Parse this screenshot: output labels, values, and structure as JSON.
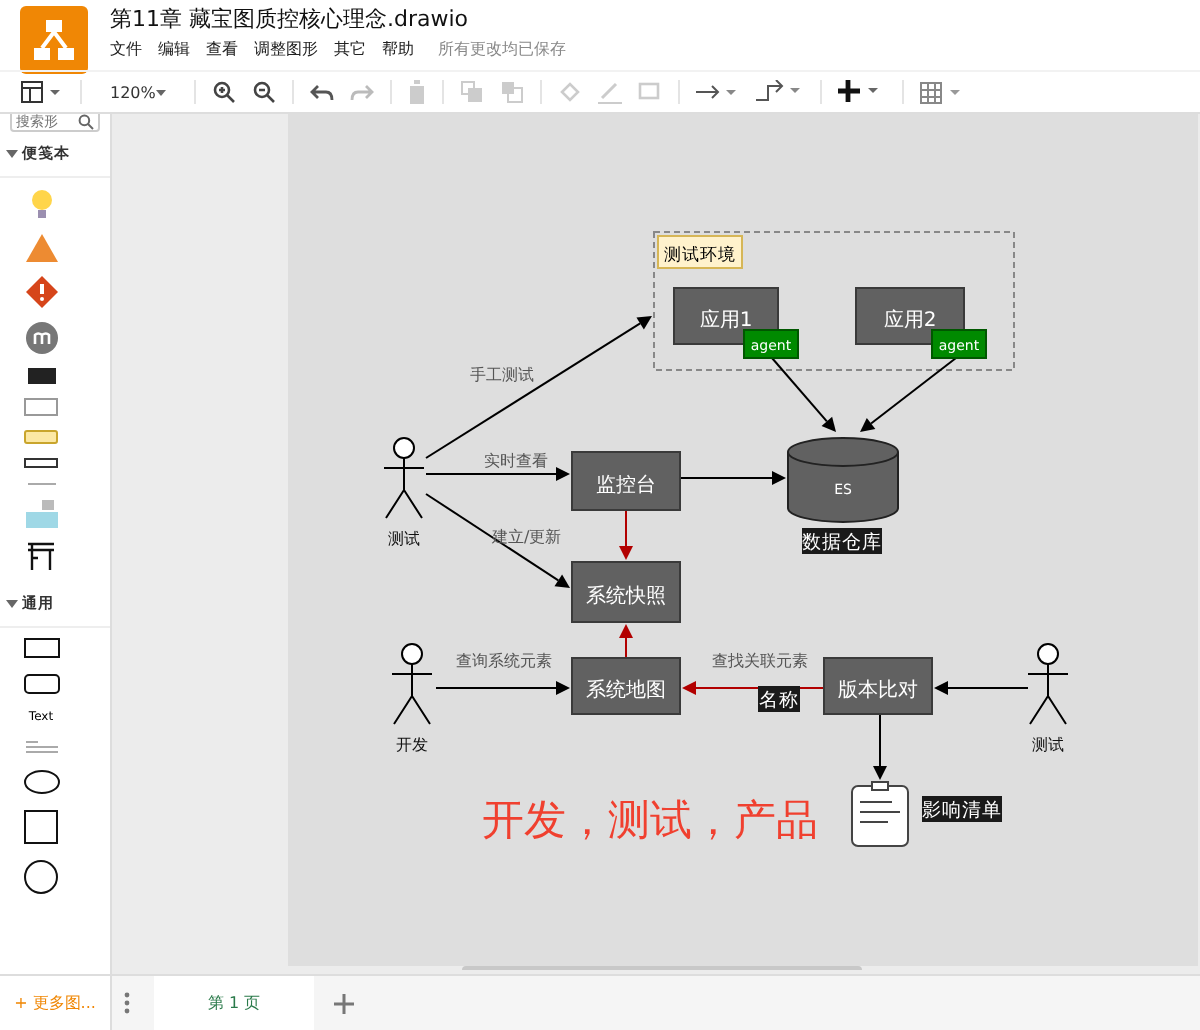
{
  "window": {
    "title": "第11章 藏宝图质控核心理念.drawio"
  },
  "menu": [
    "文件",
    "编辑",
    "查看",
    "调整图形",
    "其它",
    "帮助"
  ],
  "save_status": "所有更改均已保存",
  "toolbar": {
    "zoom": "120%"
  },
  "sidebar": {
    "search": {
      "placeholder": "搜索形"
    },
    "sections": [
      {
        "title": "便笺本",
        "expanded": true
      },
      {
        "title": "通用",
        "expanded": true
      }
    ],
    "general_text": "Text",
    "more_button": "+ 更多图..."
  },
  "diagram": {
    "group": {
      "label": "测试环境"
    },
    "nodes": [
      {
        "kind": "box",
        "text": "应用1"
      },
      {
        "kind": "box",
        "text": "应用2"
      },
      {
        "kind": "badge",
        "text": "agent"
      },
      {
        "kind": "badge",
        "text": "agent"
      },
      {
        "kind": "database",
        "text": "ES"
      },
      {
        "kind": "actor",
        "text": "测试"
      },
      {
        "kind": "box",
        "text": "监控台"
      },
      {
        "kind": "box",
        "text": "系统快照"
      },
      {
        "kind": "box",
        "text": "系统地图"
      },
      {
        "kind": "box",
        "text": "版本比对"
      },
      {
        "kind": "actor",
        "text": "开发"
      },
      {
        "kind": "actor",
        "text": "测试"
      },
      {
        "kind": "document"
      }
    ],
    "labels": [
      {
        "kind": "edge",
        "text": "手工测试"
      },
      {
        "kind": "edge",
        "text": "实时查看"
      },
      {
        "kind": "edge",
        "text": "建立/更新"
      },
      {
        "kind": "edge",
        "text": "查询系统元素"
      },
      {
        "kind": "edge",
        "text": "查找关联元素"
      },
      {
        "kind": "tag",
        "text": "数据仓库"
      },
      {
        "kind": "tag",
        "text": "名称"
      },
      {
        "kind": "tag",
        "text": "影响清单"
      },
      {
        "kind": "caption",
        "text": "开发，测试，产品"
      }
    ],
    "edges": [
      {
        "color": "#000000"
      },
      {
        "color": "#000000"
      },
      {
        "color": "#000000"
      },
      {
        "color": "#000000"
      },
      {
        "color": "#b20000"
      },
      {
        "color": "#000000"
      },
      {
        "color": "#000000"
      },
      {
        "color": "#b20000"
      },
      {
        "color": "#000000"
      },
      {
        "color": "#b20000"
      },
      {
        "color": "#000000"
      },
      {
        "color": "#000000"
      }
    ]
  },
  "pages": [
    {
      "label": "第 1 页",
      "selected": true
    }
  ]
}
